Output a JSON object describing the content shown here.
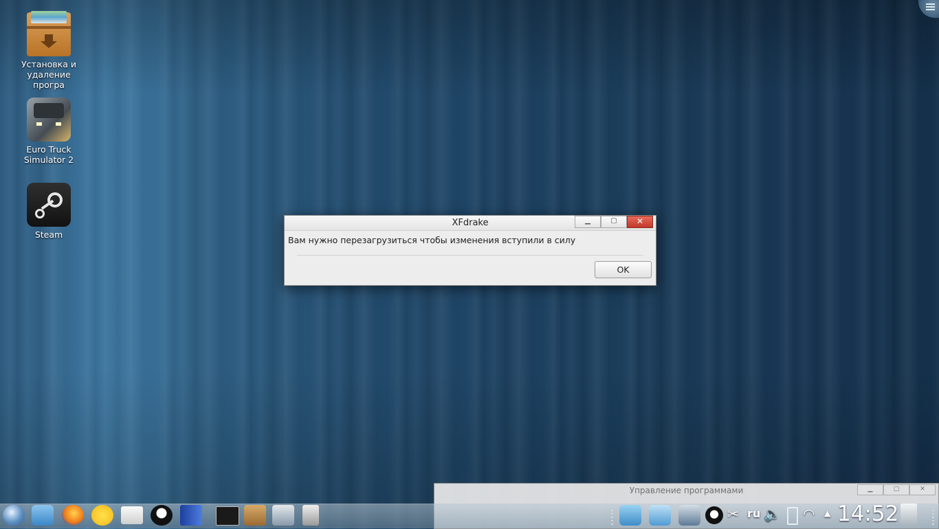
{
  "desktop": {
    "icons": [
      {
        "label_line1": "Установка и",
        "label_line2": "удаление програ",
        "icon": "package-box-icon"
      },
      {
        "label_line1": "Euro Truck",
        "label_line2": "Simulator 2",
        "icon": "truck-icon"
      },
      {
        "label_line1": "Steam",
        "label_line2": "",
        "icon": "steam-icon"
      }
    ]
  },
  "dialog": {
    "title": "XFdrake",
    "message": "Вам нужно перезагрузиться чтобы изменения вступили в силу",
    "ok_label": "OK"
  },
  "background_window": {
    "title": "Управление программами"
  },
  "taskbar": {
    "language": "ru",
    "clock": "14:52",
    "apps": [
      "launcher-menu-icon",
      "file-manager-icon",
      "firefox-icon",
      "chat-icon",
      "mail-icon",
      "penguin-game-icon",
      "sega-icon",
      "terminal-icon",
      "package-install-icon",
      "scanner-icon",
      "archive-icon"
    ],
    "tray": [
      "workspace-icon",
      "window-switcher-icon",
      "system-settings-icon",
      "penguin-tray-icon",
      "scissors-icon",
      "volume-icon",
      "battery-icon",
      "wifi-icon",
      "tray-expand-icon",
      "trash-icon"
    ]
  },
  "colors": {
    "close_button": "#c0392b",
    "dialog_bg": "#ededed"
  }
}
